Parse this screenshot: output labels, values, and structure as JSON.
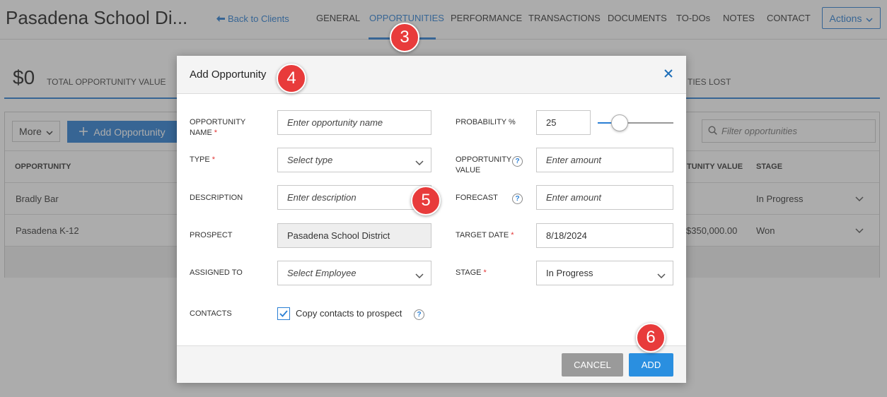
{
  "header": {
    "client_title": "Pasadena School Di...",
    "back_link": "Back to Clients",
    "tabs": [
      {
        "label": "GENERAL"
      },
      {
        "label": "OPPORTUNITIES"
      },
      {
        "label": "PERFORMANCE"
      },
      {
        "label": "TRANSACTIONS"
      },
      {
        "label": "DOCUMENTS"
      },
      {
        "label": "TO-DOs"
      },
      {
        "label": "NOTES"
      },
      {
        "label": "CONTACT"
      }
    ],
    "active_tab": "OPPORTUNITIES",
    "actions_label": "Actions"
  },
  "summary": {
    "total_value": "$0",
    "total_label": "TOTAL OPPORTUNITY VALUE",
    "lost_label": "TIES LOST"
  },
  "toolbar": {
    "more_label": "More",
    "add_label": "Add Opportunity",
    "filter_placeholder": "Filter opportunities"
  },
  "table": {
    "headers": {
      "opportunity": "OPPORTUNITY",
      "value": "TUNITY VALUE",
      "stage": "STAGE"
    },
    "rows": [
      {
        "name": "Bradly Bar",
        "value": "",
        "stage": "In Progress"
      },
      {
        "name": "Pasadena K-12",
        "value": "$350,000.00",
        "stage": "Won"
      }
    ]
  },
  "modal": {
    "title": "Add Opportunity",
    "fields": {
      "opportunity_name": {
        "label": "OPPORTUNITY NAME",
        "placeholder": "Enter opportunity name",
        "required": true
      },
      "type": {
        "label": "TYPE",
        "placeholder": "Select type",
        "required": true
      },
      "description": {
        "label": "DESCRIPTION",
        "placeholder": "Enter description"
      },
      "prospect": {
        "label": "PROSPECT",
        "value": "Pasadena School District"
      },
      "assigned_to": {
        "label": "ASSIGNED TO",
        "placeholder": "Select Employee"
      },
      "contacts": {
        "label": "CONTACTS",
        "checkbox_label": "Copy contacts to prospect",
        "checked": true
      },
      "probability": {
        "label": "PROBABILITY %",
        "value": "25",
        "slider_fraction": 0.25
      },
      "opportunity_value": {
        "label": "OPPORTUNITY VALUE",
        "placeholder": "Enter amount"
      },
      "forecast": {
        "label": "FORECAST",
        "placeholder": "Enter amount"
      },
      "target_date": {
        "label": "TARGET DATE",
        "value": "8/18/2024",
        "required": true
      },
      "stage": {
        "label": "STAGE",
        "value": "In Progress",
        "required": true
      }
    },
    "cancel_label": "CANCEL",
    "add_label": "ADD",
    "help_glyph": "?",
    "required_mark": "*"
  },
  "markers": {
    "m3": "3",
    "m4": "4",
    "m5": "5",
    "m6": "6"
  },
  "colors": {
    "accent": "#2a7fd4",
    "marker": "#e83b3b",
    "required": "#e23636"
  }
}
